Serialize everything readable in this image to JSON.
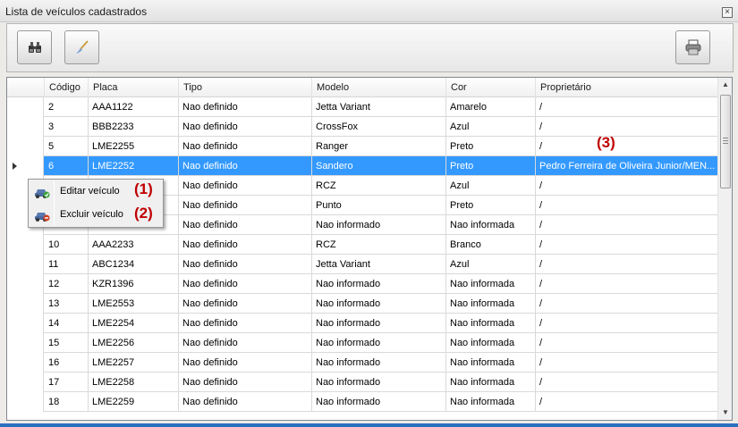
{
  "window": {
    "title": "Lista de veículos cadastrados",
    "close_symbol": "×"
  },
  "toolbar": {
    "buttons": [
      {
        "name": "search-button",
        "icon": "binoculars-icon"
      },
      {
        "name": "clean-button",
        "icon": "brush-icon"
      },
      {
        "name": "print-button",
        "icon": "printer-icon"
      }
    ]
  },
  "grid": {
    "columns": [
      "Código",
      "Placa",
      "Tipo",
      "Modelo",
      "Cor",
      "Proprietário"
    ],
    "rows": [
      {
        "codigo": "2",
        "placa": "AAA1122",
        "tipo": "Nao definido",
        "modelo": "Jetta Variant",
        "cor": "Amarelo",
        "proprietario": "/"
      },
      {
        "codigo": "3",
        "placa": "BBB2233",
        "tipo": "Nao definido",
        "modelo": "CrossFox",
        "cor": "Azul",
        "proprietario": "/"
      },
      {
        "codigo": "5",
        "placa": "LME2255",
        "tipo": "Nao definido",
        "modelo": "Ranger",
        "cor": "Preto",
        "proprietario": "/"
      },
      {
        "codigo": "6",
        "placa": "LME2252",
        "tipo": "Nao definido",
        "modelo": "Sandero",
        "cor": "Preto",
        "proprietario": "Pedro Ferreira de Oliveira Junior/MEN..."
      },
      {
        "codigo": "",
        "placa": "",
        "tipo": "Nao definido",
        "modelo": "RCZ",
        "cor": "Azul",
        "proprietario": "/"
      },
      {
        "codigo": "",
        "placa": "",
        "tipo": "Nao definido",
        "modelo": "Punto",
        "cor": "Preto",
        "proprietario": "/"
      },
      {
        "codigo": "",
        "placa": "",
        "tipo": "Nao definido",
        "modelo": "Nao informado",
        "cor": "Nao informada",
        "proprietario": "/"
      },
      {
        "codigo": "10",
        "placa": "AAA2233",
        "tipo": "Nao definido",
        "modelo": "RCZ",
        "cor": "Branco",
        "proprietario": "/"
      },
      {
        "codigo": "11",
        "placa": "ABC1234",
        "tipo": "Nao definido",
        "modelo": "Jetta Variant",
        "cor": "Azul",
        "proprietario": "/"
      },
      {
        "codigo": "12",
        "placa": "KZR1396",
        "tipo": "Nao definido",
        "modelo": "Nao informado",
        "cor": "Nao informada",
        "proprietario": "/"
      },
      {
        "codigo": "13",
        "placa": "LME2553",
        "tipo": "Nao definido",
        "modelo": "Nao informado",
        "cor": "Nao informada",
        "proprietario": "/"
      },
      {
        "codigo": "14",
        "placa": "LME2254",
        "tipo": "Nao definido",
        "modelo": "Nao informado",
        "cor": "Nao informada",
        "proprietario": "/"
      },
      {
        "codigo": "15",
        "placa": "LME2256",
        "tipo": "Nao definido",
        "modelo": "Nao informado",
        "cor": "Nao informada",
        "proprietario": "/"
      },
      {
        "codigo": "16",
        "placa": "LME2257",
        "tipo": "Nao definido",
        "modelo": "Nao informado",
        "cor": "Nao informada",
        "proprietario": "/"
      },
      {
        "codigo": "17",
        "placa": "LME2258",
        "tipo": "Nao definido",
        "modelo": "Nao informado",
        "cor": "Nao informada",
        "proprietario": "/"
      },
      {
        "codigo": "18",
        "placa": "LME2259",
        "tipo": "Nao definido",
        "modelo": "Nao informado",
        "cor": "Nao informada",
        "proprietario": "/"
      }
    ],
    "selected_row_index": 3,
    "selection_color": "#3399ff"
  },
  "context_menu": {
    "items": [
      {
        "label": "Editar veículo",
        "icon": "car-edit-icon"
      },
      {
        "label": "Excluir veículo",
        "icon": "car-delete-icon"
      }
    ]
  },
  "annotations": [
    "(1)",
    "(2)",
    "(3)"
  ],
  "colors": {
    "annotation": "#c00000",
    "selection": "#3399ff"
  }
}
